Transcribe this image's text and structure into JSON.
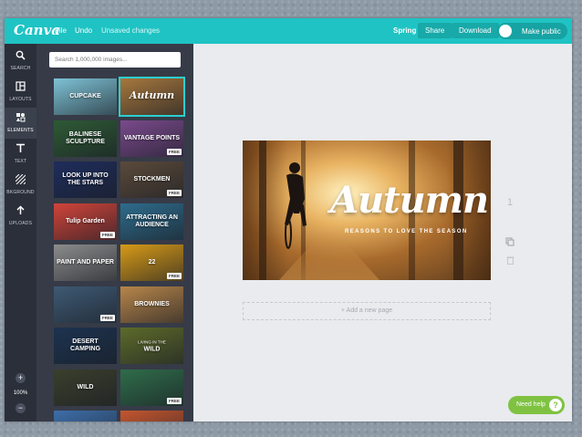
{
  "app": {
    "logo": "Canva",
    "menu": {
      "file": "File",
      "undo": "Undo",
      "status": "Unsaved changes"
    },
    "design_title": "Spring",
    "buttons": {
      "share": "Share",
      "download": "Download",
      "make_public": "Make public"
    }
  },
  "rail": {
    "items": [
      {
        "label": "SEARCH",
        "icon": "search-icon"
      },
      {
        "label": "LAYOUTS",
        "icon": "layouts-icon"
      },
      {
        "label": "ELEMENTS",
        "icon": "elements-icon"
      },
      {
        "label": "TEXT",
        "icon": "text-icon"
      },
      {
        "label": "BKGROUND",
        "icon": "background-icon"
      },
      {
        "label": "UPLOADS",
        "icon": "upload-icon"
      }
    ],
    "zoom": "100%",
    "zoom_in": "+",
    "zoom_out": "−"
  },
  "panel": {
    "search_placeholder": "Search 1,000,000 images...",
    "free_badge": "FREE",
    "templates": [
      {
        "text": "CUPCAKE",
        "sub": "",
        "free": false,
        "color": "#7ec3d6"
      },
      {
        "text": "Autumn",
        "sub": "",
        "free": false,
        "color": "#a7773d"
      },
      {
        "text": "BALINESE SCULPTURE",
        "sub": "",
        "free": false,
        "color": "#2e5a35"
      },
      {
        "text": "VANTAGE POINTS",
        "sub": "",
        "free": true,
        "color": "#7a4a8c"
      },
      {
        "text": "LOOK UP INTO THE STARS",
        "sub": "",
        "free": false,
        "color": "#1e2d5c"
      },
      {
        "text": "STOCKMEN",
        "sub": "",
        "free": true,
        "color": "#5b4a3a"
      },
      {
        "text": "Tulip Garden",
        "sub": "",
        "free": true,
        "color": "#d0443a"
      },
      {
        "text": "ATTRACTING AN AUDIENCE",
        "sub": "",
        "free": false,
        "color": "#2e6c8c"
      },
      {
        "text": "PAINT AND PAPER",
        "sub": "",
        "free": false,
        "color": "#8c8c8c"
      },
      {
        "text": "22",
        "sub": "",
        "free": true,
        "color": "#d79a18"
      },
      {
        "text": "",
        "sub": "",
        "free": true,
        "color": "#3e5a74"
      },
      {
        "text": "BROWNIES",
        "sub": "",
        "free": false,
        "color": "#b8864a"
      },
      {
        "text": "DESERT CAMPING",
        "sub": "",
        "free": false,
        "color": "#1c3350"
      },
      {
        "text": "WILD",
        "sub": "LIVING IN THE",
        "free": false,
        "color": "#5d6b2a"
      },
      {
        "text": "WILD",
        "sub": "",
        "free": false,
        "color": "#3a3f2c"
      },
      {
        "text": "",
        "sub": "",
        "free": true,
        "color": "#2f6d4a"
      },
      {
        "text": "",
        "sub": "",
        "free": false,
        "color": "#3d6ea8"
      },
      {
        "text": "",
        "sub": "",
        "free": false,
        "color": "#c4562f"
      }
    ]
  },
  "canvas": {
    "title": "Autumn",
    "subtitle": "REASONS TO LOVE THE SEASON",
    "page_number": "1",
    "add_page": "+ Add a new page"
  },
  "help": {
    "label": "Need help",
    "icon": "?"
  },
  "colors": {
    "accent": "#1fc3c3",
    "rail": "#2b2f3a",
    "panel": "#363b47",
    "help": "#7fc242"
  }
}
